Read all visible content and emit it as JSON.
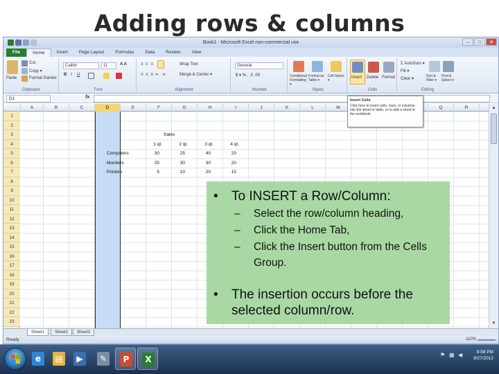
{
  "slide": {
    "title": "Adding rows & columns",
    "bullets": [
      {
        "text": "To INSERT a Row/Column:",
        "sub": [
          "Select the row/column heading,",
          "Click the Home Tab,",
          "Click the Insert button from the Cells Group."
        ]
      },
      {
        "text": "The insertion occurs before the selected column/row.",
        "sub": []
      }
    ],
    "bullet_glyph": "•",
    "sub_glyph": "–"
  },
  "window": {
    "title": "Book1 - Microsoft Excel non-commercial use",
    "controls": [
      "–",
      "□",
      "✕"
    ]
  },
  "ribbon": {
    "tabs": [
      "File",
      "Home",
      "Insert",
      "Page Layout",
      "Formulas",
      "Data",
      "Review",
      "View"
    ],
    "active_tab": "Home",
    "clipboard": {
      "paste": "Paste",
      "cut": "Cut",
      "copy": "Copy ▾",
      "format_painter": "Format Painter",
      "label": "Clipboard"
    },
    "font": {
      "name": "Calibri",
      "size": "11",
      "label": "Font"
    },
    "alignment": {
      "wrap": "Wrap Text",
      "merge": "Merge & Center ▾",
      "label": "Alignment"
    },
    "number": {
      "format": "General",
      "label": "Number"
    },
    "styles": {
      "conditional": "Conditional Formatting ▾",
      "format_table": "Format as Table ▾",
      "cell_styles": "Cell Styles ▾",
      "label": "Styles"
    },
    "cells": {
      "insert": "Insert",
      "delete": "Delete",
      "format": "Format",
      "label": "Cells"
    },
    "editing": {
      "autosum": "Σ AutoSum ▾",
      "fill": "Fill ▾",
      "clear": "Clear ▾",
      "sort": "Sort & Filter ▾",
      "find": "Find & Select ▾",
      "label": "Editing"
    }
  },
  "formula_bar": {
    "name_box": "D1",
    "fx": "fx",
    "value": ""
  },
  "tooltip": {
    "title": "Insert Cells",
    "body": "Click here to insert cells, rows, or columns into the sheet or table, or to add a sheet to the workbook."
  },
  "grid": {
    "columns": [
      "A",
      "B",
      "C",
      "D",
      "E",
      "F",
      "G",
      "H",
      "I",
      "J",
      "K",
      "L",
      "M",
      "N",
      "O",
      "P",
      "Q",
      "R",
      "S"
    ],
    "selected_column": "D",
    "rows": [
      "1",
      "2",
      "3",
      "4",
      "5",
      "6",
      "7",
      "8",
      "9",
      "10",
      "11",
      "12",
      "13",
      "14",
      "15",
      "16",
      "17",
      "18",
      "19",
      "20",
      "21",
      "22",
      "23"
    ],
    "sales_header": "Sales",
    "quarters": [
      "1 qt.",
      "2 qt.",
      "3 qt.",
      "4 qt."
    ],
    "table": [
      {
        "item": "Computers",
        "values": [
          "30",
          "25",
          "40",
          "20"
        ]
      },
      {
        "item": "Monitors",
        "values": [
          "25",
          "30",
          "30",
          "20"
        ]
      },
      {
        "item": "Printers",
        "values": [
          "5",
          "10",
          "20",
          "15"
        ]
      }
    ]
  },
  "sheets": {
    "tabs": [
      "Sheet1",
      "Sheet2",
      "Sheet3"
    ],
    "active": "Sheet1"
  },
  "status": {
    "ready": "Ready",
    "zoom": "110%"
  },
  "taskbar": {
    "apps": [
      {
        "name": "ie",
        "glyph": "e",
        "color": "#2f86d6"
      },
      {
        "name": "explorer",
        "glyph": "▤",
        "color": "#e4b340"
      },
      {
        "name": "media",
        "glyph": "▶",
        "color": "#3b6fb0"
      },
      {
        "name": "paint",
        "glyph": "✎",
        "color": "#7a8fa6"
      },
      {
        "name": "powerpoint",
        "glyph": "P",
        "color": "#d0492c"
      },
      {
        "name": "excel",
        "glyph": "X",
        "color": "#2a7d2e"
      }
    ],
    "time": "8:58 PM",
    "date": "9/27/2012"
  },
  "colors": {
    "callout": "#a9d8a4",
    "selected_column": "#c6dcf5",
    "file_tab": "#2a7d2e"
  }
}
